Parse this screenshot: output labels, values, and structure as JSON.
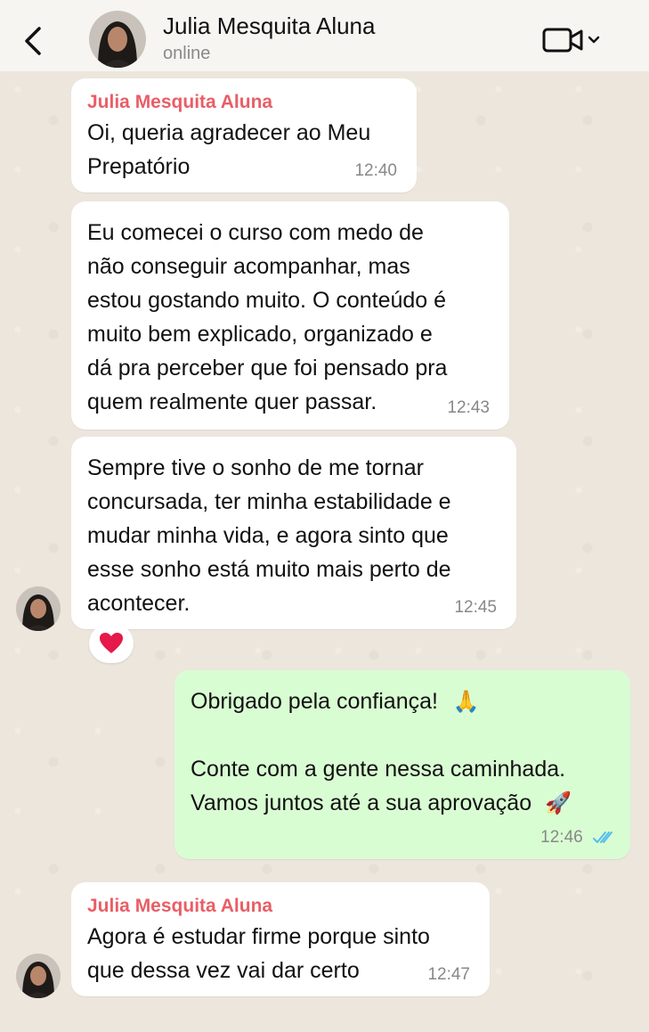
{
  "header": {
    "contact_name": "Julia Mesquita Aluna",
    "status": "online"
  },
  "messages": [
    {
      "direction": "incoming",
      "sender": "Julia Mesquita Aluna",
      "text": "Oi, queria agradecer ao Meu\nPrepatório",
      "time": "12:40"
    },
    {
      "direction": "incoming",
      "text": "Eu comecei o curso com medo de\nnão conseguir acompanhar, mas\nestou gostando muito. O conteúdo é\nmuito bem explicado, organizado e\ndá pra perceber que foi pensado pra\nquem realmente quer passar.",
      "time": "12:43"
    },
    {
      "direction": "incoming",
      "text": "Sempre tive o sonho de me tornar\nconcursada, ter minha estabilidade e\nmudar minha vida, e agora sinto que\nesse sonho está muito mais perto de\nacontecer.",
      "time": "12:45",
      "reaction": "❤️"
    },
    {
      "direction": "outgoing",
      "line1": "Obrigado pela confiança!",
      "emoji1": "🙏",
      "line2": "Conte com a gente nessa caminhada.",
      "line3": "Vamos juntos até a sua aprovação",
      "emoji2": "🚀",
      "time": "12:46",
      "status": "read"
    },
    {
      "direction": "incoming",
      "sender": "Julia Mesquita Aluna",
      "text": "Agora é estudar firme porque sinto\nque dessa vez vai dar certo",
      "time": "12:47"
    }
  ],
  "colors": {
    "sender_name": "#e95e66",
    "outgoing_bubble": "#d9fdd3",
    "read_ticks": "#53bdeb",
    "chat_background": "#ece6dd"
  },
  "icons": [
    "back-arrow-icon",
    "video-call-icon",
    "chevron-down-icon",
    "double-check-icon",
    "heart-icon"
  ]
}
